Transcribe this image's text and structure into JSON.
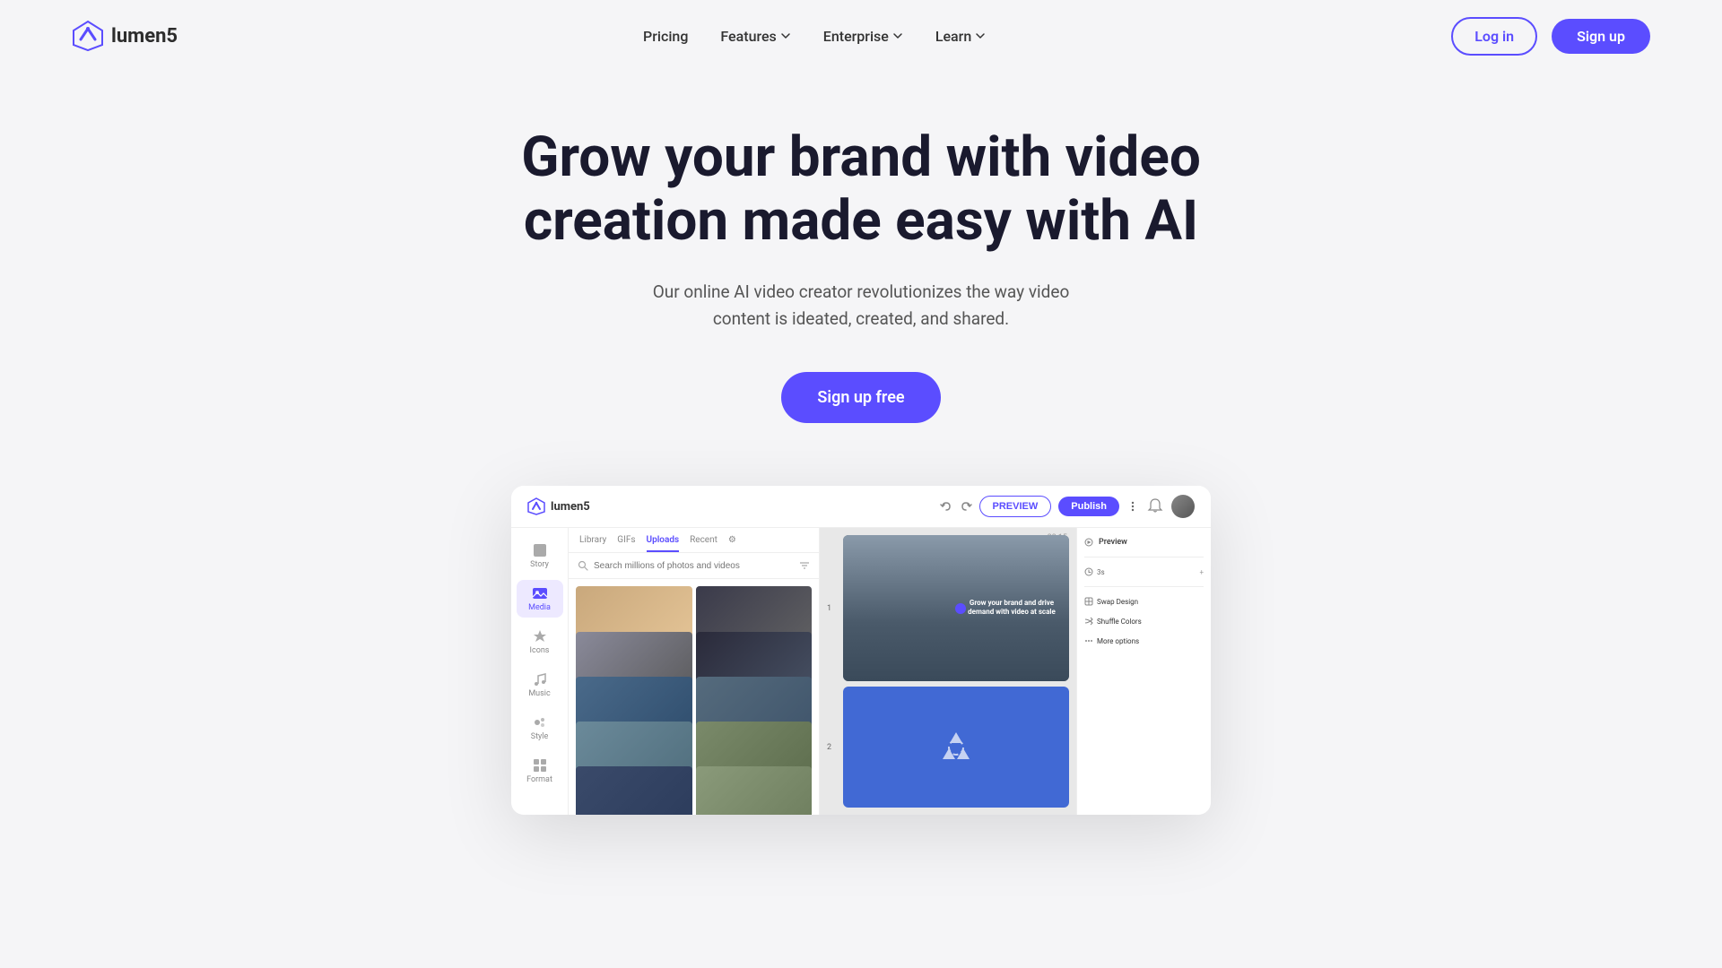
{
  "brand": {
    "name": "lumen5",
    "logo_color": "#5b4dff"
  },
  "nav": {
    "pricing_label": "Pricing",
    "features_label": "Features",
    "enterprise_label": "Enterprise",
    "learn_label": "Learn",
    "login_label": "Log in",
    "signup_label": "Sign up"
  },
  "hero": {
    "title": "Grow your brand with video creation made easy with AI",
    "subtitle": "Our online AI video creator revolutionizes the way video content is ideated, created, and shared.",
    "cta_label": "Sign up free"
  },
  "app_ui": {
    "logo_text": "lumen5",
    "preview_label": "PREVIEW",
    "publish_label": "Publish",
    "tabs": [
      "Library",
      "GIFs",
      "Uploads",
      "Recent"
    ],
    "active_tab": "Uploads",
    "search_placeholder": "Search millions of photos and videos",
    "sidebar_items": [
      {
        "label": "Story",
        "icon": "story"
      },
      {
        "label": "Media",
        "icon": "media",
        "active": true
      },
      {
        "label": "Icons",
        "icon": "icons"
      },
      {
        "label": "Music",
        "icon": "music"
      },
      {
        "label": "Style",
        "icon": "style"
      },
      {
        "label": "Format",
        "icon": "format"
      }
    ],
    "canvas_text": "Grow your brand and drive demand with video at scale",
    "right_panel": {
      "items": [
        "Preview",
        "Swap Design",
        "Shuffle Colors",
        "More options"
      ]
    },
    "timer": "00:15"
  },
  "colors": {
    "primary": "#5b4dff",
    "bg": "#f5f5f7",
    "text_dark": "#1a1a2e",
    "text_muted": "#555"
  }
}
